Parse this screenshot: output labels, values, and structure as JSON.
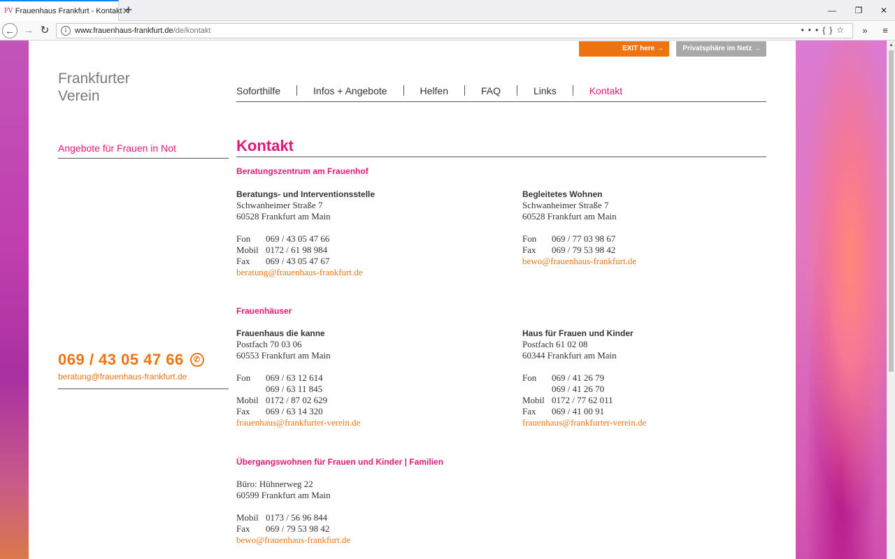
{
  "browser": {
    "tab_favicon": "FV",
    "tab_title": "Frauenhaus Frankfurt - Kontakt",
    "url_domain": "www.frauenhaus-frankfurt.de",
    "url_path": "/de/kontakt"
  },
  "header": {
    "exit_button": "EXIT here",
    "privacy_button": "Privatsphäre im Netz",
    "logo_line1": "Frankfurter",
    "logo_line2": "Verein"
  },
  "nav": {
    "items": [
      {
        "label": "Soforthilfe",
        "active": false
      },
      {
        "label": "Infos + Angebote",
        "active": false
      },
      {
        "label": "Helfen",
        "active": false
      },
      {
        "label": "FAQ",
        "active": false
      },
      {
        "label": "Links",
        "active": false
      },
      {
        "label": "Kontakt",
        "active": true
      }
    ]
  },
  "sidebar": {
    "link": "Angebote für Frauen in Not",
    "phone": "069 / 43 05 47 66",
    "email": "beratung@frauenhaus-frankfurt.de"
  },
  "main": {
    "title": "Kontakt",
    "sections": [
      {
        "heading": "Beratungszentrum am Frauenhof",
        "cards": [
          {
            "name": "Beratungs- und Interventionsstelle",
            "address": [
              "Schwanheimer Straße 7",
              "60528 Frankfurt am Main"
            ],
            "contacts": [
              {
                "label": "Fon",
                "value": "069 / 43 05 47 66"
              },
              {
                "label": "Mobil",
                "value": "0172 / 61 98 984"
              },
              {
                "label": "Fax",
                "value": "069 / 43 05 47 67"
              }
            ],
            "email": "beratung@frauenhaus-frankfurt.de"
          },
          {
            "name": "Begleitetes Wohnen",
            "address": [
              "Schwanheimer Straße 7",
              "60528 Frankfurt am Main"
            ],
            "contacts": [
              {
                "label": "Fon",
                "value": "069 / 77 03 98 67"
              },
              {
                "label": "Fax",
                "value": "069 / 79 53 98 42"
              }
            ],
            "email": "bewo@frauenhaus-frankfurt.de"
          }
        ]
      },
      {
        "heading": "Frauenhäuser",
        "cards": [
          {
            "name": "Frauenhaus die kanne",
            "address": [
              "Postfach 70 03 06",
              "60553 Frankfurt am Main"
            ],
            "contacts": [
              {
                "label": "Fon",
                "value": "069 / 63 12 614"
              },
              {
                "label": "",
                "value": "069 / 63 11 845"
              },
              {
                "label": "Mobil",
                "value": "0172 / 87 02 629"
              },
              {
                "label": "Fax",
                "value": "069 / 63 14 320"
              }
            ],
            "email": "frauenhaus@frankfurter-verein.de"
          },
          {
            "name": "Haus für Frauen und Kinder",
            "address": [
              "Postfach 61 02 08",
              "60344 Frankfurt am Main"
            ],
            "contacts": [
              {
                "label": "Fon",
                "value": "069 / 41 26 79"
              },
              {
                "label": "",
                "value": "069 / 41 26 70"
              },
              {
                "label": "Mobil",
                "value": "0172 / 77 62 011"
              },
              {
                "label": "Fax",
                "value": "069 / 41 00 91"
              }
            ],
            "email": "frauenhaus@frankfurter-verein.de"
          }
        ]
      },
      {
        "heading": "Übergangswohnen für Frauen und Kinder | Familien",
        "cards": [
          {
            "name": "",
            "address": [
              "Büro: Hühnerweg 22",
              "60599 Frankfurt am Main"
            ],
            "contacts": [
              {
                "label": "Mobil",
                "value": "0173 / 56 96 844"
              },
              {
                "label": "Fax",
                "value": "069 / 79 53 98 42"
              }
            ],
            "email": "bewo@frauenhaus-frankfurt.de"
          }
        ]
      }
    ]
  }
}
